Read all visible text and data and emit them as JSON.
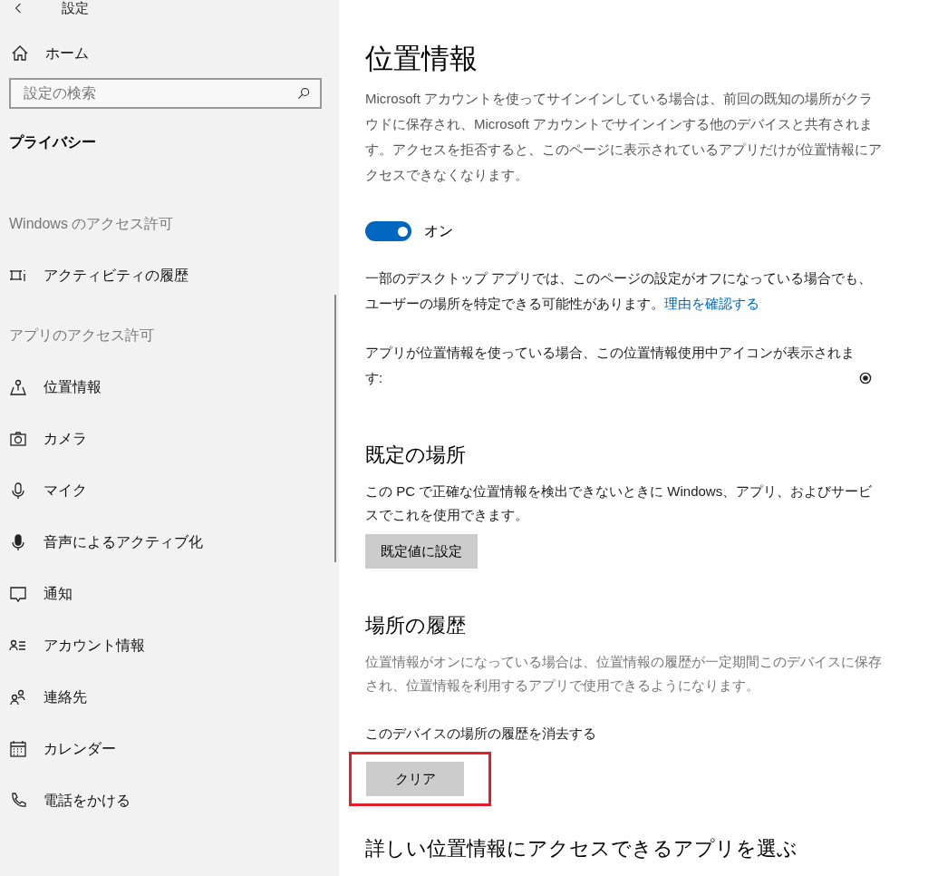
{
  "window": {
    "title": "設定"
  },
  "sidebar": {
    "home": "ホーム",
    "search": {
      "placeholder": "設定の検索"
    },
    "category": "プライバシー",
    "groups": [
      {
        "heading": "Windows のアクセス許可",
        "items": [
          {
            "kind": "activity",
            "label": "アクティビティの履歴"
          }
        ]
      },
      {
        "heading": "アプリのアクセス許可",
        "items": [
          {
            "kind": "location",
            "label": "位置情報"
          },
          {
            "kind": "camera",
            "label": "カメラ"
          },
          {
            "kind": "mic",
            "label": "マイク"
          },
          {
            "kind": "voice",
            "label": "音声によるアクティブ化"
          },
          {
            "kind": "notification",
            "label": "通知"
          },
          {
            "kind": "account",
            "label": "アカウント情報"
          },
          {
            "kind": "contacts",
            "label": "連絡先"
          },
          {
            "kind": "calendar",
            "label": "カレンダー"
          },
          {
            "kind": "phone",
            "label": "電話をかける"
          }
        ]
      }
    ]
  },
  "page": {
    "title": "位置情報",
    "intro": "Microsoft アカウントを使ってサインインしている場合は、前回の既知の場所がクラウドに保存され、Microsoft アカウントでサインインする他のデバイスと共有されます。アクセスを拒否すると、このページに表示されているアプリだけが位置情報にアクセスできなくなります。",
    "toggle": {
      "on": true,
      "label": "オン"
    },
    "desktop_note": "一部のデスクトップ アプリでは、このページの設定がオフになっている場合でも、ユーザーの場所を特定できる可能性があります。",
    "desktop_link": "理由を確認する",
    "icon_note": "アプリが位置情報を使っている場合、この位置情報使用中アイコンが表示されます:",
    "sections": [
      {
        "title": "既定の場所",
        "text": "この PC で正確な位置情報を検出できないときに Windows、アプリ、およびサービスでこれを使用できます。",
        "button": {
          "label": "既定値に設定",
          "highlighted": false
        }
      },
      {
        "title": "場所の履歴",
        "text": "位置情報がオンになっている場合は、位置情報の履歴が一定期間このデバイスに保存され、位置情報を利用するアプリで使用できるようになります。",
        "subtitle": "このデバイスの場所の履歴を消去する",
        "button": {
          "label": "クリア",
          "highlighted": true
        }
      }
    ],
    "next_heading": "詳しい位置情報にアクセスできるアプリを選ぶ"
  }
}
